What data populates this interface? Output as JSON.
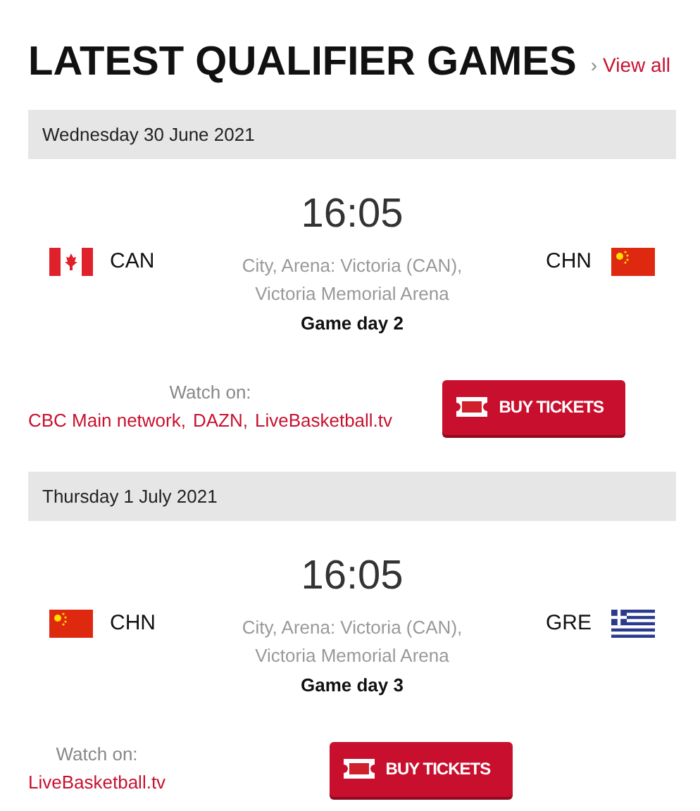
{
  "title": "LATEST QUALIFIER GAMES",
  "view_all": {
    "arrow": "›",
    "label": "View all"
  },
  "games": [
    {
      "date": "Wednesday 30 June 2021",
      "time": "16:05",
      "home": {
        "code": "CAN",
        "kind": "canada"
      },
      "away": {
        "code": "CHN",
        "kind": "china"
      },
      "venue": "City, Arena: Victoria (CAN), Victoria Memorial Arena",
      "game_day": "Game day 2",
      "watch_label": "Watch on:",
      "broadcasters": [
        "CBC Main network,",
        "DAZN,",
        "LiveBasketball.tv"
      ],
      "button": "BUY TICKETS"
    },
    {
      "date": "Thursday 1 July 2021",
      "time": "16:05",
      "home": {
        "code": "CHN",
        "kind": "china"
      },
      "away": {
        "code": "GRE",
        "kind": "greece"
      },
      "venue": "City, Arena: Victoria (CAN), Victoria Memorial Arena",
      "game_day": "Game day 3",
      "watch_label": "Watch on:",
      "broadcasters": [
        "LiveBasketball.tv"
      ],
      "button": "BUY TICKETS"
    }
  ]
}
